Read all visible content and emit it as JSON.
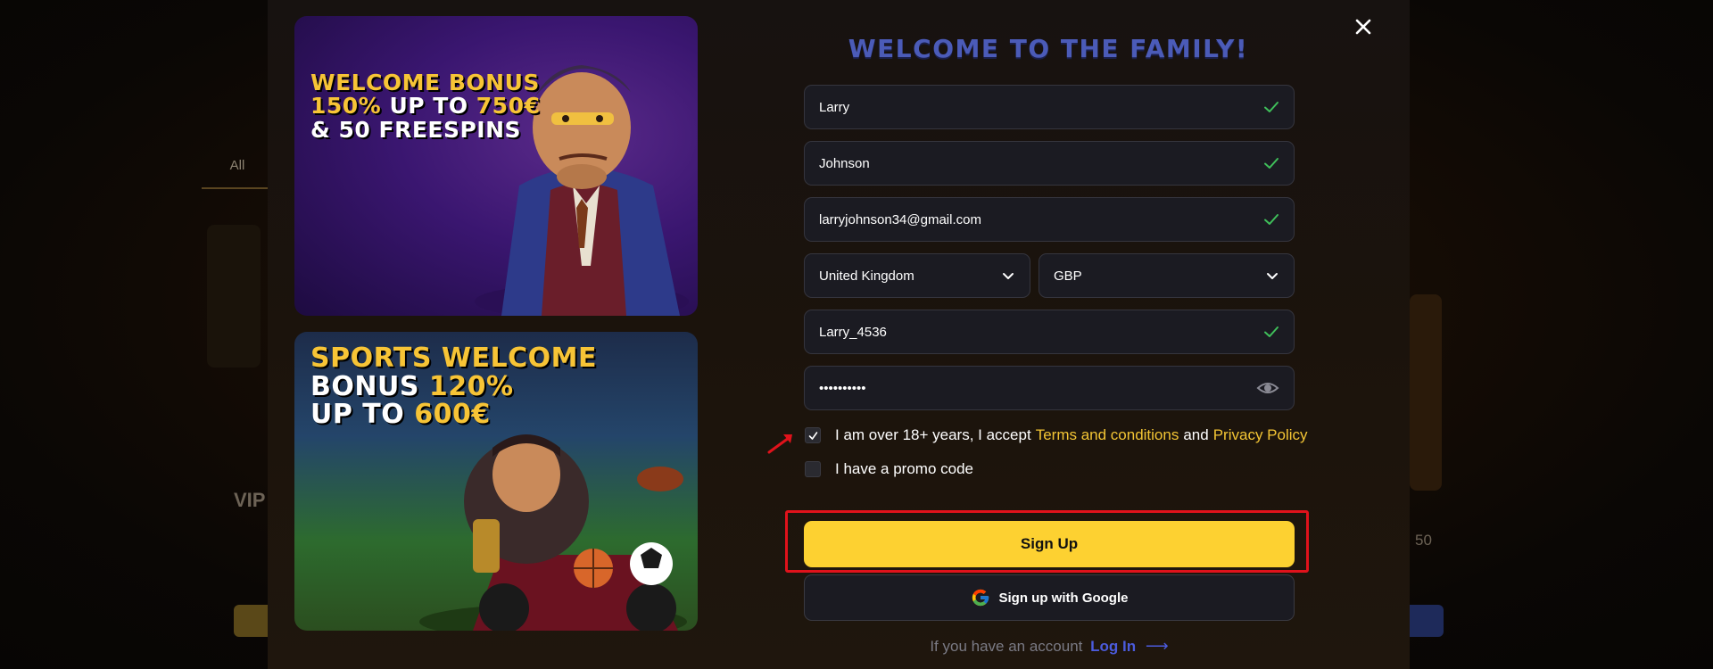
{
  "background": {
    "tab_all": "All",
    "vip_label": "VIP",
    "number_label": "50"
  },
  "modal": {
    "title": "WELCOME TO THE FAMILY!",
    "banners": [
      {
        "lines": [
          {
            "parts": [
              {
                "text": "WELCOME BONUS",
                "color": "yellow"
              }
            ]
          },
          {
            "parts": [
              {
                "text": "150%",
                "color": "yellow"
              },
              {
                "text": " UP TO ",
                "color": "white"
              },
              {
                "text": "750€",
                "color": "yellow"
              }
            ]
          },
          {
            "parts": [
              {
                "text": "& 50 FREESPINS",
                "color": "white"
              }
            ]
          }
        ]
      },
      {
        "lines": [
          {
            "parts": [
              {
                "text": "SPORTS WELCOME",
                "color": "yellow"
              }
            ]
          },
          {
            "parts": [
              {
                "text": "BONUS ",
                "color": "white"
              },
              {
                "text": "120%",
                "color": "yellow"
              }
            ]
          },
          {
            "parts": [
              {
                "text": "UP TO ",
                "color": "white"
              },
              {
                "text": "600€",
                "color": "yellow"
              }
            ]
          }
        ]
      }
    ],
    "form": {
      "first_name": "Larry",
      "last_name": "Johnson",
      "email": "larryjohnson34@gmail.com",
      "country": "United Kingdom",
      "currency": "GBP",
      "username": "Larry_4536",
      "password_masked": "••••••••••",
      "terms_text": "I am over 18+ years, I accept",
      "terms_link": "Terms and conditions",
      "terms_and": "and",
      "privacy_link": "Privacy Policy",
      "terms_checked": true,
      "promo_text": "I have a promo code",
      "promo_checked": false,
      "signup_label": "Sign Up",
      "google_label": "Sign up with Google",
      "login_prompt": "If you have an account",
      "login_link": "Log In"
    }
  },
  "colors": {
    "accent_yellow": "#fdd131",
    "link_gold": "#f3c534",
    "title_blue": "#4b5bb8",
    "success_green": "#3fbf5a",
    "highlight_red": "#e0121b"
  },
  "icons": [
    "close-icon",
    "check-icon",
    "chevron-down-icon",
    "eye-icon",
    "google-icon",
    "arrow-right-icon"
  ]
}
